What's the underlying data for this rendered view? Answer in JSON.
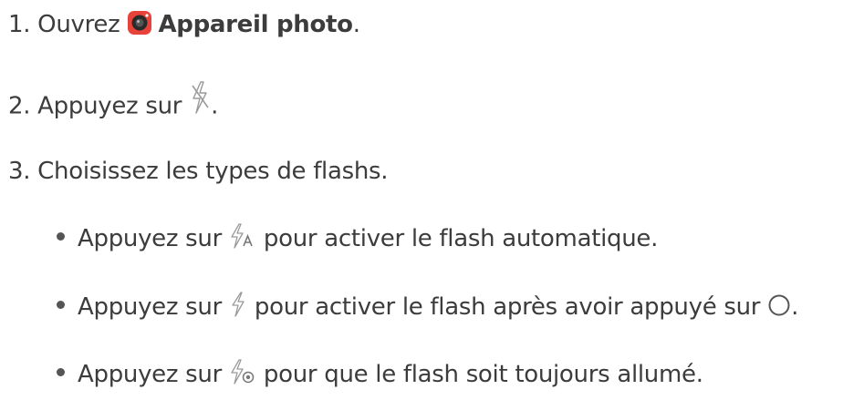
{
  "steps": [
    {
      "number": "1.",
      "text_before": " Ouvrez ",
      "app_name": "Appareil photo",
      "text_after": ".",
      "icon": "camera-app-icon"
    },
    {
      "number": "2.",
      "text_before": " Appuyez sur ",
      "text_after": ".",
      "icon": "flash-off-icon"
    },
    {
      "number": "3.",
      "text": " Choisissez les types de flashs."
    }
  ],
  "bullets": [
    {
      "text_before": "Appuyez sur ",
      "text_after": " pour activer le flash automatique.",
      "icon": "flash-auto-icon"
    },
    {
      "text_before": "Appuyez sur ",
      "text_after": " pour activer le flash après avoir appuyé sur ",
      "icon": "flash-on-icon",
      "icon2": "shutter-button-icon",
      "text_end": "."
    },
    {
      "text_before": "Appuyez sur ",
      "text_after": " pour que le flash soit toujours allumé.",
      "icon": "flash-always-on-icon"
    }
  ],
  "colors": {
    "text": "#3c3c3c",
    "camera_icon_red": "#e8433a",
    "camera_icon_dark": "#2a2a2a",
    "icon_stroke": "#9a9a9a"
  }
}
